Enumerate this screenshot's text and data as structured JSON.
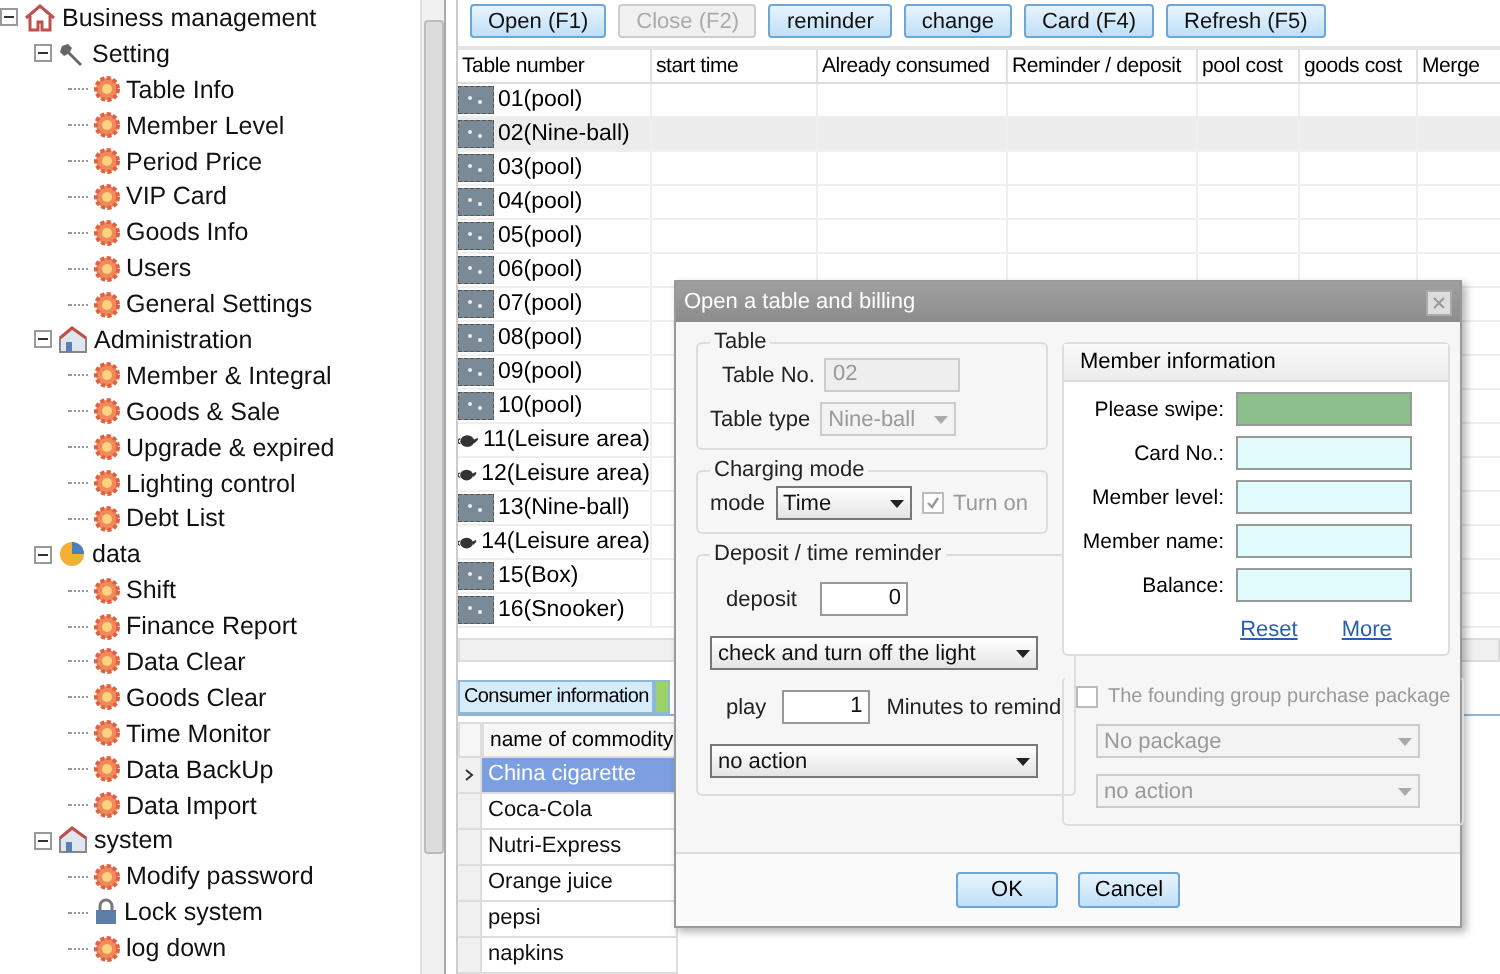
{
  "tree": {
    "label": "Business management",
    "kind": "house",
    "expanded": true,
    "children": [
      {
        "label": "Setting",
        "kind": "wrench",
        "expanded": true,
        "children": [
          {
            "label": "Table Info",
            "kind": "gear"
          },
          {
            "label": "Member Level",
            "kind": "gear"
          },
          {
            "label": "Period Price",
            "kind": "gear"
          },
          {
            "label": "VIP Card",
            "kind": "gear"
          },
          {
            "label": "Goods Info",
            "kind": "gear"
          },
          {
            "label": "Users",
            "kind": "gear"
          },
          {
            "label": "General Settings",
            "kind": "gear"
          }
        ]
      },
      {
        "label": "Administration",
        "kind": "building",
        "expanded": true,
        "children": [
          {
            "label": "Member & Integral",
            "kind": "gear"
          },
          {
            "label": "Goods & Sale",
            "kind": "gear"
          },
          {
            "label": "Upgrade & expired",
            "kind": "gear"
          },
          {
            "label": "Lighting control",
            "kind": "gear"
          },
          {
            "label": "Debt List",
            "kind": "gear"
          }
        ]
      },
      {
        "label": "data",
        "kind": "pie",
        "expanded": true,
        "children": [
          {
            "label": "Shift",
            "kind": "gear"
          },
          {
            "label": "Finance Report",
            "kind": "gear"
          },
          {
            "label": "Data Clear",
            "kind": "gear"
          },
          {
            "label": "Goods Clear",
            "kind": "gear"
          },
          {
            "label": "Time Monitor",
            "kind": "gear"
          },
          {
            "label": "Data BackUp",
            "kind": "gear"
          },
          {
            "label": "Data Import",
            "kind": "gear"
          }
        ]
      },
      {
        "label": "system",
        "kind": "building",
        "expanded": true,
        "children": [
          {
            "label": "Modify password",
            "kind": "gear"
          },
          {
            "label": "Lock system",
            "kind": "lock"
          },
          {
            "label": "log down",
            "kind": "gear"
          }
        ]
      }
    ]
  },
  "toolbar": [
    {
      "label": "Open (F1)",
      "disabled": false
    },
    {
      "label": "Close (F2)",
      "disabled": true
    },
    {
      "label": "reminder",
      "disabled": false
    },
    {
      "label": "change",
      "disabled": false
    },
    {
      "label": "Card (F4)",
      "disabled": false
    },
    {
      "label": "Refresh (F5)",
      "disabled": false
    }
  ],
  "table": {
    "columns": [
      "Table number",
      "start time",
      "Already consumed",
      "Reminder / deposit",
      "pool cost",
      "goods cost",
      "Merge"
    ],
    "rows": [
      {
        "name": "01(pool)",
        "kind": "table",
        "selected": false
      },
      {
        "name": "02(Nine-ball)",
        "kind": "table",
        "selected": true
      },
      {
        "name": "03(pool)",
        "kind": "table",
        "selected": false
      },
      {
        "name": "04(pool)",
        "kind": "table",
        "selected": false
      },
      {
        "name": "05(pool)",
        "kind": "table",
        "selected": false
      },
      {
        "name": "06(pool)",
        "kind": "table",
        "selected": false
      },
      {
        "name": "07(pool)",
        "kind": "table",
        "selected": false
      },
      {
        "name": "08(pool)",
        "kind": "table",
        "selected": false
      },
      {
        "name": "09(pool)",
        "kind": "table",
        "selected": false
      },
      {
        "name": "10(pool)",
        "kind": "table",
        "selected": false
      },
      {
        "name": "11(Leisure area)",
        "kind": "teapot",
        "selected": false
      },
      {
        "name": "12(Leisure area)",
        "kind": "teapot",
        "selected": false
      },
      {
        "name": "13(Nine-ball)",
        "kind": "table",
        "selected": false
      },
      {
        "name": "14(Leisure area)",
        "kind": "teapot",
        "selected": false
      },
      {
        "name": "15(Box)",
        "kind": "table",
        "selected": false
      },
      {
        "name": "16(Snooker)",
        "kind": "table",
        "selected": false
      }
    ]
  },
  "bottom_tabs": [
    {
      "label": "Consumer information",
      "selected": true
    }
  ],
  "goods": {
    "column": "name of commodity",
    "rows": [
      {
        "name": "China cigarette",
        "selected": true
      },
      {
        "name": "Coca-Cola",
        "selected": false
      },
      {
        "name": "Nutri-Express",
        "selected": false
      },
      {
        "name": "Orange juice",
        "selected": false
      },
      {
        "name": "pepsi",
        "selected": false
      },
      {
        "name": "napkins",
        "selected": false
      }
    ]
  },
  "dialog": {
    "title": "Open a table and billing",
    "table_group": {
      "title": "Table",
      "table_no_label": "Table No.",
      "table_no": "02",
      "table_type_label": "Table type",
      "table_type": "Nine-ball"
    },
    "charging": {
      "title": "Charging mode",
      "mode_label": "mode",
      "mode": "Time",
      "turn_on_label": "Turn on",
      "turn_on": true
    },
    "reminder": {
      "title": "Deposit / time reminder",
      "deposit_label": "deposit",
      "deposit": "0",
      "light_action": "check and turn off the light",
      "play_label": "play",
      "play": "1",
      "minutes_label": "Minutes to remind",
      "action": "no action"
    },
    "member": {
      "title": "Member information",
      "fields": [
        {
          "label": "Please swipe:",
          "kind": "swipe"
        },
        {
          "label": "Card No.:",
          "kind": "text"
        },
        {
          "label": "Member level:",
          "kind": "text"
        },
        {
          "label": "Member name:",
          "kind": "text"
        },
        {
          "label": "Balance:",
          "kind": "text"
        }
      ],
      "links": [
        "Reset",
        "More"
      ]
    },
    "package": {
      "label": "The founding group purchase package",
      "checked": false,
      "package": "No package",
      "action": "no action"
    },
    "buttons": [
      "OK",
      "Cancel"
    ]
  }
}
